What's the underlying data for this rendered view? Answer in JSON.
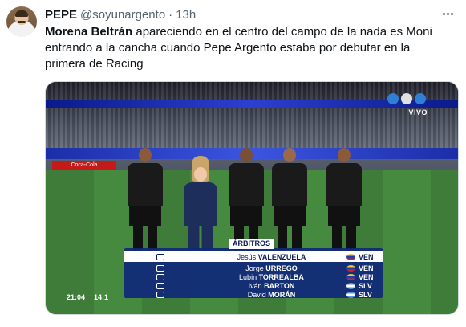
{
  "tweet": {
    "author_name": "PEPE",
    "author_handle": "@soyunargento",
    "separator": "·",
    "time_ago": "13h",
    "text_bold": "Morena Beltrán",
    "text_line1_rest": " apareciendo en el centro del campo de la nada es Moni",
    "text_line2": "entrando a la cancha cuando Pepe Argento estaba por debutar en la",
    "text_line3": "primera de Racing"
  },
  "media": {
    "broadcast_tag": "VIVO",
    "ad_text": "Coca-Cola",
    "clock": "21:04",
    "match_minute": "14:1",
    "caption_title": "ÁRBITROS",
    "officials": [
      {
        "first": "Jesús",
        "last": "VALENZUELA",
        "code": "VEN",
        "flag_color": "#f4c430"
      },
      {
        "first": "Jorge",
        "last": "URREGO",
        "code": "VEN",
        "flag_color": "#f4c430"
      },
      {
        "first": "Lubin",
        "last": "TORREALBA",
        "code": "VEN",
        "flag_color": "#f4c430"
      },
      {
        "first": "Iván",
        "last": "BARTON",
        "code": "SLV",
        "flag_color": "#5b8fd6"
      },
      {
        "first": "David",
        "last": "MORÁN",
        "code": "SLV",
        "flag_color": "#5b8fd6"
      }
    ]
  },
  "icons": {
    "more": "more-horizontal-icon",
    "role_whistle": "whistle-icon",
    "role_flag": "linesman-flag-icon",
    "role_screen": "var-screen-icon"
  }
}
